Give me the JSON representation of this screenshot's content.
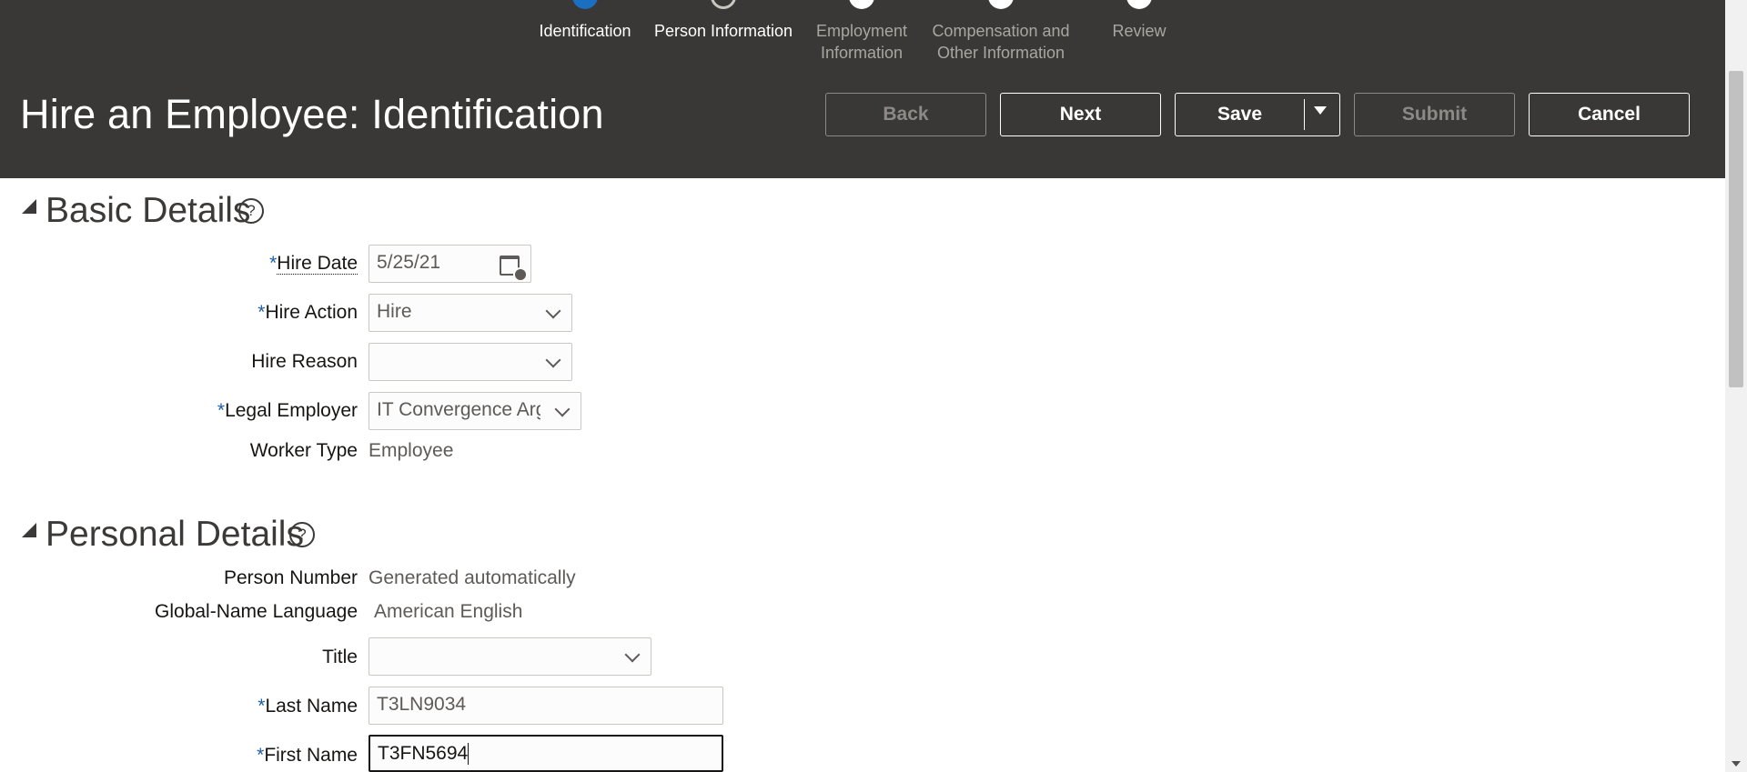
{
  "train": {
    "steps": [
      {
        "label": "Identification"
      },
      {
        "label": "Person Information"
      },
      {
        "label": "Employment Information"
      },
      {
        "label": "Compensation and Other Information"
      },
      {
        "label": "Review"
      }
    ]
  },
  "header": {
    "title": "Hire an Employee: Identification",
    "back": "Back",
    "next": "Next",
    "save": "Save",
    "submit": "Submit",
    "cancel": "Cancel"
  },
  "basic_details": {
    "title": "Basic Details",
    "hire_date": {
      "label": "Hire Date",
      "value": "5/25/21"
    },
    "hire_action": {
      "label": "Hire Action",
      "value": "Hire"
    },
    "hire_reason": {
      "label": "Hire Reason",
      "value": ""
    },
    "legal_employer": {
      "label": "Legal Employer",
      "value": "IT Convergence Arg"
    },
    "worker_type": {
      "label": "Worker Type",
      "value": "Employee"
    }
  },
  "personal_details": {
    "title": "Personal Details",
    "person_number": {
      "label": "Person Number",
      "value": "Generated automatically"
    },
    "global_name_language": {
      "label": "Global-Name Language",
      "value": "American English"
    },
    "title_field": {
      "label": "Title",
      "value": ""
    },
    "last_name": {
      "label": "Last Name",
      "value": "T3LN9034"
    },
    "first_name": {
      "label": "First Name",
      "value": "T3FN5694"
    }
  },
  "required_marker": "*",
  "help_glyph": "?",
  "colors": {
    "header_bg": "#3a3836",
    "accent": "#1b6fc2",
    "required": "#1b5fa8"
  }
}
